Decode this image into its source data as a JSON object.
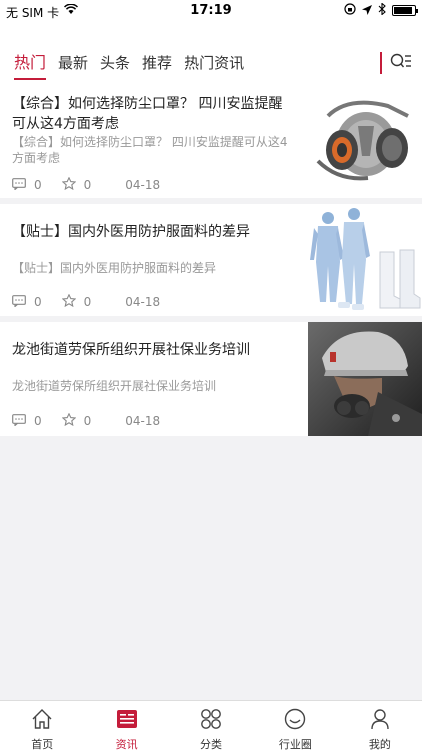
{
  "status": {
    "carrier": "无 SIM 卡",
    "time": "17:19",
    "battery_level": 0.9
  },
  "tabs": [
    {
      "label": "热门",
      "active": true
    },
    {
      "label": "最新",
      "active": false
    },
    {
      "label": "头条",
      "active": false
    },
    {
      "label": "推荐",
      "active": false
    },
    {
      "label": "热门资讯",
      "active": false
    }
  ],
  "tab_more_icon": "search-list-icon",
  "articles": [
    {
      "title": "【综合】如何选择防尘口罩？ 四川安监提醒可从这4方面考虑",
      "summary": "【综合】如何选择防尘口罩？ 四川安监提醒可从这4方面考虑",
      "comments": "0",
      "likes": "0",
      "date": "04-18",
      "thumb": "respirator-mask-image"
    },
    {
      "title": "【贴士】国内外医用防护服面料的差异",
      "summary": "【贴士】国内外医用防护服面料的差异",
      "comments": "0",
      "likes": "0",
      "date": "04-18",
      "thumb": "protective-suit-image"
    },
    {
      "title": "龙池街道劳保所组织开展社保业务培训",
      "summary": "龙池街道劳保所组织开展社保业务培训",
      "comments": "0",
      "likes": "0",
      "date": "04-18",
      "thumb": "worker-helmet-image"
    }
  ],
  "tabbar": [
    {
      "label": "首页",
      "icon": "home-icon",
      "active": false
    },
    {
      "label": "资讯",
      "icon": "news-icon",
      "active": true
    },
    {
      "label": "分类",
      "icon": "category-icon",
      "active": false
    },
    {
      "label": "行业圈",
      "icon": "circle-icon",
      "active": false
    },
    {
      "label": "我的",
      "icon": "user-icon",
      "active": false
    }
  ],
  "colors": {
    "accent": "#c41c3a",
    "background": "#f2f2f4"
  }
}
